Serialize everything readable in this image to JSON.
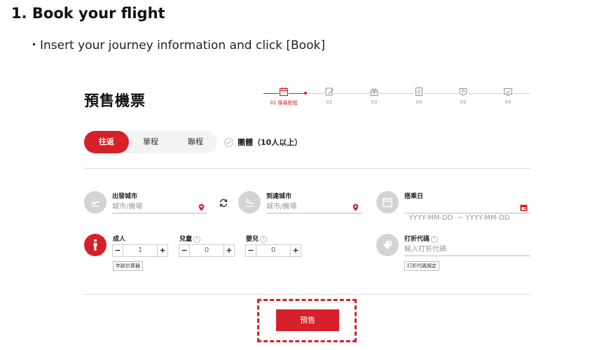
{
  "instructions": {
    "heading": "1. Book your flight",
    "subline": "・Insert your journey information and click [Book]"
  },
  "page_title": "預售機票",
  "stepper": {
    "steps": [
      {
        "label": "01 搜尋航程",
        "icon": "calendar-icon",
        "active": true
      },
      {
        "label": "02",
        "icon": "edit-icon",
        "active": false
      },
      {
        "label": "03",
        "icon": "gift-icon",
        "active": false
      },
      {
        "label": "04",
        "icon": "document-icon",
        "active": false
      },
      {
        "label": "05",
        "icon": "id-card-icon",
        "active": false
      },
      {
        "label": "06",
        "icon": "monitor-icon",
        "active": false
      }
    ]
  },
  "trip_type": {
    "tabs": [
      "往返",
      "單程",
      "聯程"
    ],
    "selected": "往返",
    "group_label": "團體（10人以上）"
  },
  "origin": {
    "label": "出發城市",
    "placeholder": "城市/機場"
  },
  "destination": {
    "label": "到達城市",
    "placeholder": "城市/機場"
  },
  "date": {
    "label": "搭乘日",
    "placeholder": "YYYY-MM-DD  ~ YYYY-MM-DD"
  },
  "passengers": {
    "adult": {
      "label": "成人",
      "value": "1"
    },
    "child": {
      "label": "兒童",
      "value": "0"
    },
    "infant": {
      "label": "嬰兒",
      "value": "0"
    },
    "age_calc_label": "年齡計算器",
    "minus": "−",
    "plus": "+",
    "help": "?"
  },
  "promo": {
    "label": "打折代碼",
    "placeholder": "輸入打折代碼",
    "rules_label": "打折代碼規定"
  },
  "book_button": "預售",
  "colors": {
    "accent": "#d6202a",
    "icon_bg": "#d3d3d3"
  }
}
